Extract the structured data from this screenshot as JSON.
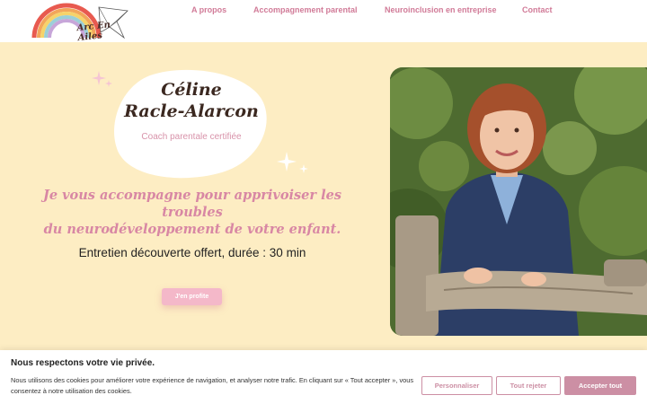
{
  "brand": {
    "logo_text": "Arc En Ailes"
  },
  "nav": {
    "items": [
      {
        "label": "A propos"
      },
      {
        "label": "Accompagnement parental"
      },
      {
        "label": "Neuroinclusion en entreprise"
      },
      {
        "label": "Contact"
      }
    ]
  },
  "hero": {
    "name_line1": "Céline",
    "name_line2": "Racle-Alarcon",
    "subtitle": "Coach parentale certifiée",
    "tagline_line1": "Je vous accompagne pour apprivoiser les troubles",
    "tagline_line2": "du neurodéveloppement de votre enfant.",
    "offer": "Entretien découverte offert, durée : 30 min",
    "cta_label": "J'en profite"
  },
  "cookie_banner": {
    "title": "Nous respectons votre vie privée.",
    "text": "Nous utilisons des cookies pour améliorer votre expérience de navigation, et analyser notre trafic. En cliquant sur « Tout accepter », vous consentez à notre utilisation des cookies.",
    "customize_label": "Personnaliser",
    "reject_label": "Tout rejeter",
    "accept_label": "Accepter tout"
  },
  "colors": {
    "hero_background": "#fdedc3",
    "accent_pink": "#d887a4",
    "cta_pink": "#f4b8c9",
    "cookie_button": "#cc8fa4"
  }
}
